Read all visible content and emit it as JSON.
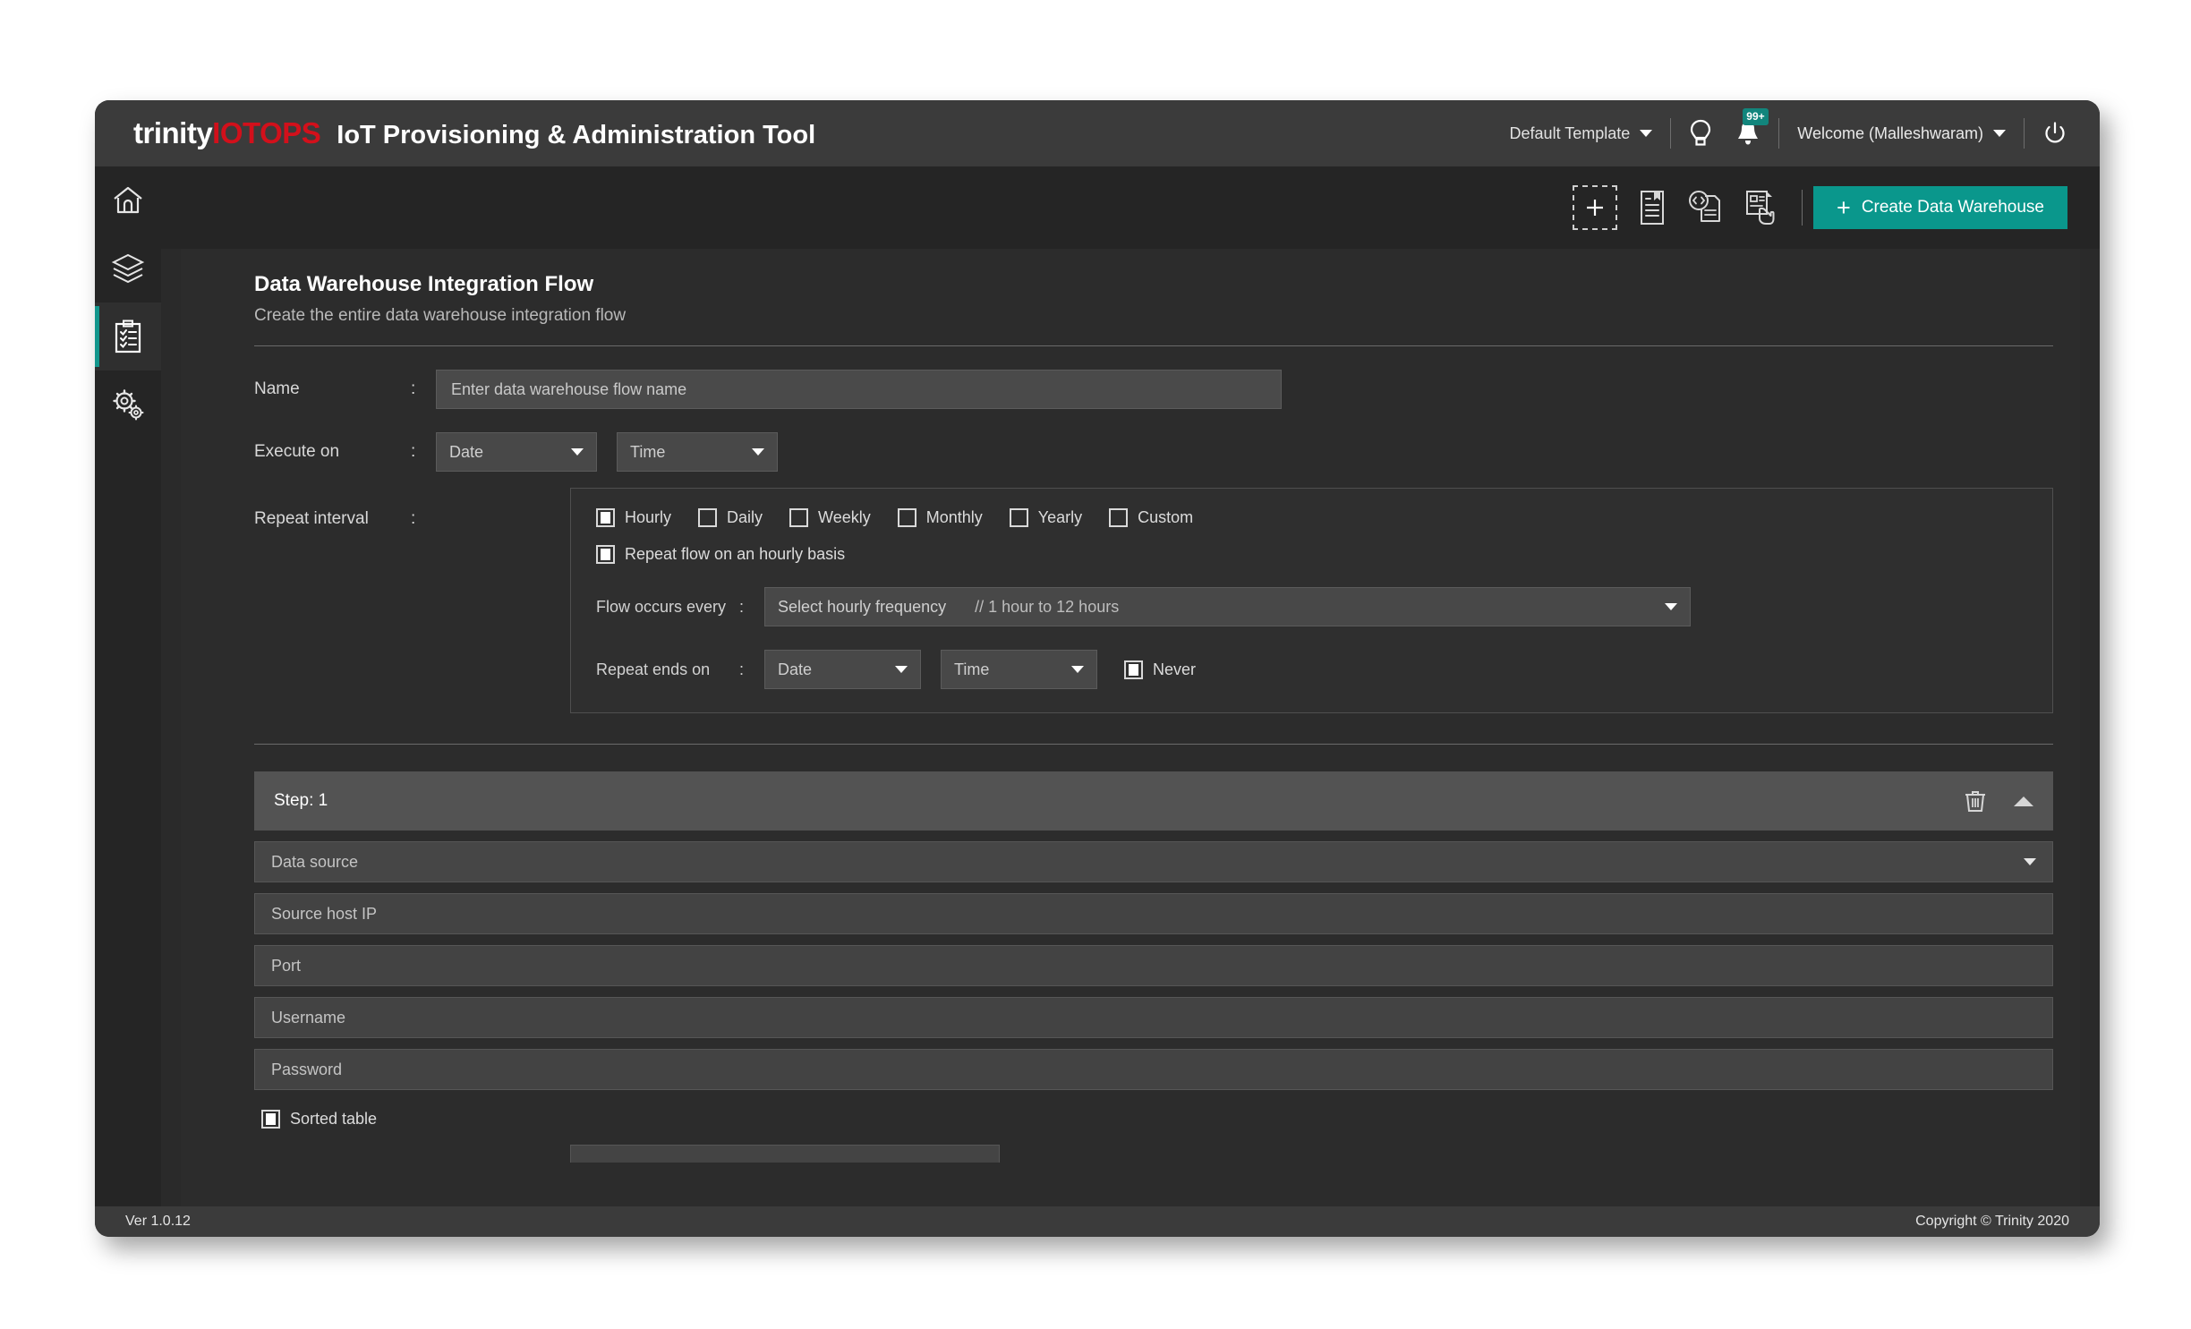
{
  "header": {
    "logo_part1": "trinity",
    "logo_part2": "IOTOPS",
    "app_title": "IoT Provisioning & Administration Tool",
    "template_label": "Default Template",
    "bulb_icon": "lightbulb-icon",
    "bell_icon": "bell-icon",
    "notification_count": "99+",
    "welcome_label": "Welcome (Malleshwaram)",
    "power_icon": "power-icon",
    "brand_red": "#d2101b",
    "accent_teal": "#0a978c"
  },
  "sidebar": {
    "items": [
      {
        "name": "home",
        "icon": "home-icon",
        "active": false
      },
      {
        "name": "layers",
        "icon": "layers-icon",
        "active": false
      },
      {
        "name": "flows",
        "icon": "clipboard-checklist-icon",
        "active": true
      },
      {
        "name": "settings",
        "icon": "gears-icon",
        "active": false
      }
    ]
  },
  "actionbar": {
    "add_icon": "dashed-plus-icon",
    "template_doc_icon": "bookmark-document-icon",
    "code_doc_icon": "code-document-icon",
    "select_doc_icon": "document-hand-icon",
    "create_button": "Create Data Warehouse",
    "create_plus": "+"
  },
  "main": {
    "title": "Data Warehouse Integration Flow",
    "subtitle": "Create the entire data warehouse integration flow",
    "colon": ":",
    "name": {
      "label": "Name",
      "placeholder": "Enter data warehouse flow name",
      "value": ""
    },
    "execute_on": {
      "label": "Execute on",
      "date_value": "Date",
      "time_value": "Time"
    },
    "repeat_interval": {
      "label": "Repeat interval",
      "options": [
        {
          "label": "Hourly",
          "checked": true
        },
        {
          "label": "Daily",
          "checked": false
        },
        {
          "label": "Weekly",
          "checked": false
        },
        {
          "label": "Monthly",
          "checked": false
        },
        {
          "label": "Yearly",
          "checked": false
        },
        {
          "label": "Custom",
          "checked": false
        }
      ],
      "repeat_basis": {
        "label": "Repeat flow on an hourly basis",
        "checked": true
      },
      "flow_occurs": {
        "label": "Flow occurs every",
        "placeholder": "Select hourly frequency",
        "hint": "// 1 hour to 12 hours"
      },
      "repeat_ends": {
        "label": "Repeat ends on",
        "date_value": "Date",
        "time_value": "Time",
        "never_label": "Never",
        "never_checked": true
      }
    },
    "step": {
      "title": "Step: 1",
      "delete_icon": "trash-icon",
      "collapse_icon": "chevron-up-icon",
      "fields": [
        {
          "name": "data-source",
          "placeholder": "Data source",
          "type": "dropdown"
        },
        {
          "name": "source-host-ip",
          "placeholder": "Source host IP",
          "type": "text"
        },
        {
          "name": "port",
          "placeholder": "Port",
          "type": "text"
        },
        {
          "name": "username",
          "placeholder": "Username",
          "type": "text"
        },
        {
          "name": "password",
          "placeholder": "Password",
          "type": "text"
        }
      ],
      "sorted_table": {
        "label": "Sorted table",
        "checked": true
      }
    }
  },
  "footer": {
    "version": "Ver 1.0.12",
    "copyright": "Copyright © Trinity 2020"
  }
}
